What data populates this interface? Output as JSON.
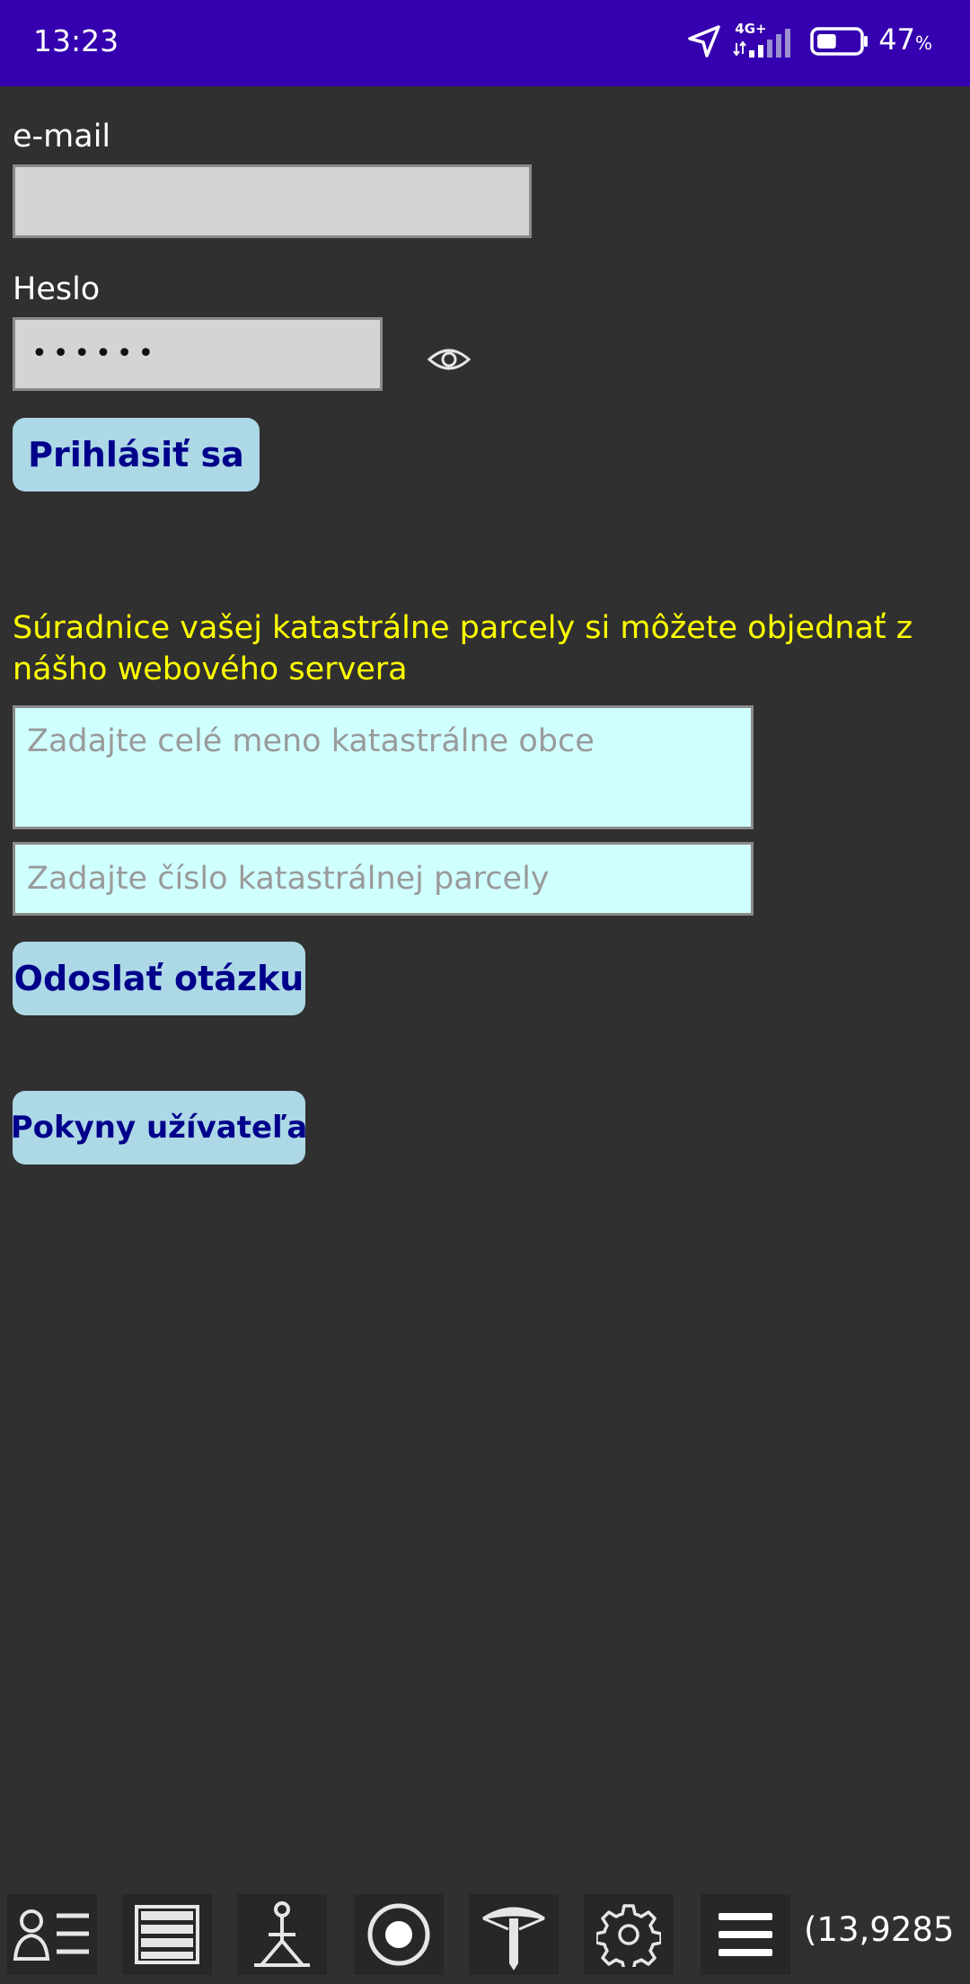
{
  "status_bar": {
    "time": "13:23",
    "network": "4G+",
    "battery_percent": "47",
    "battery_unit": "%",
    "battery_level": 0.47,
    "icons": [
      "location-arrow-icon",
      "signal-icon",
      "battery-icon"
    ]
  },
  "login": {
    "email_label": "e-mail",
    "email_value": "",
    "password_label": "Heslo",
    "password_mask": "••••••",
    "show_password_icon": "eye-icon",
    "login_button": "Prihlásiť sa"
  },
  "order": {
    "info_text": "Súradnice vašej katastrálne parcely si môžete objednať z nášho webového servera",
    "cadastral_area_placeholder": "Zadajte celé meno katastrálne obce",
    "parcel_number_placeholder": "Zadajte číslo katastrálnej parcely",
    "send_button": "Odoslať otázku",
    "guide_button": "Pokyny užívateľa"
  },
  "toolbar": {
    "icons": [
      "user-list-icon",
      "layers-icon",
      "survey-point-icon",
      "target-icon",
      "mushroom-marker-icon",
      "gear-icon",
      "menu-icon"
    ],
    "coordinate": "(13,9285"
  },
  "colors": {
    "status_bar": "#3500af",
    "background": "#303030",
    "button_bg": "#add8e6",
    "button_text": "#00008b",
    "info_text": "#ffff00",
    "input_gray": "#d4d4d4",
    "input_cyan": "#d0ffff"
  }
}
